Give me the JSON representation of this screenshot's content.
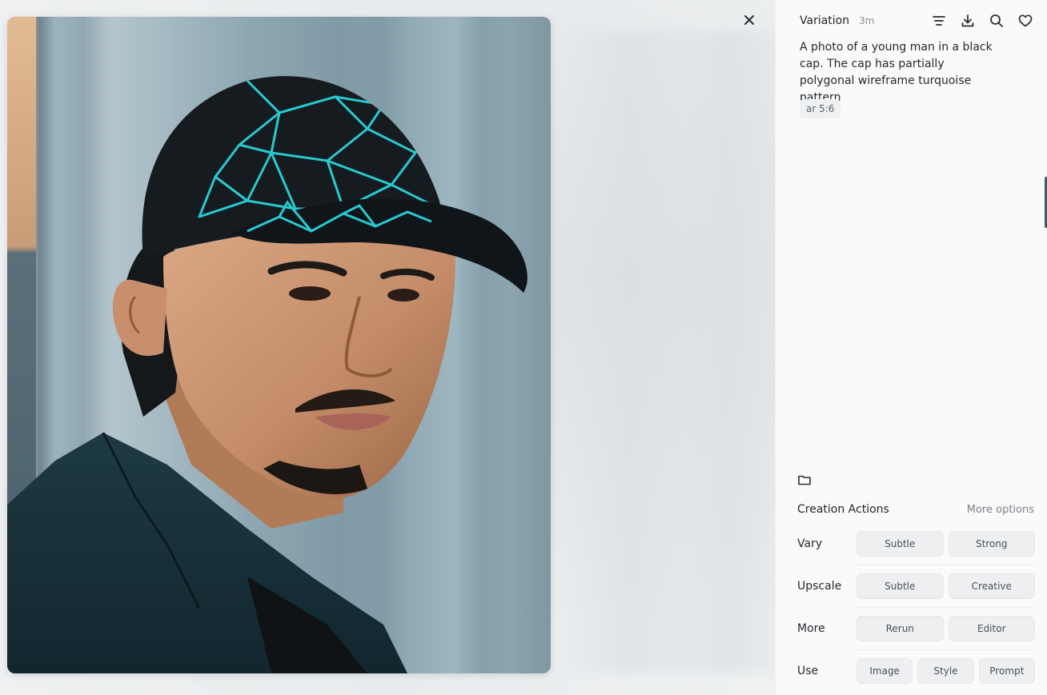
{
  "sidebar": {
    "title": "Variation",
    "age": "3m",
    "prompt": "A photo of a young man in a black cap. The cap has partially polygonal wireframe turquoise pattern",
    "tag": "ar 5:6",
    "icons": [
      "menu-icon",
      "download-icon",
      "search-icon",
      "heart-icon"
    ]
  },
  "actions": {
    "title": "Creation Actions",
    "more_options": "More options",
    "rows": [
      {
        "label": "Vary",
        "buttons": [
          "Subtle",
          "Strong"
        ]
      },
      {
        "label": "Upscale",
        "buttons": [
          "Subtle",
          "Creative"
        ]
      },
      {
        "label": "More",
        "buttons": [
          "Rerun",
          "Editor"
        ]
      },
      {
        "label": "Use",
        "buttons": [
          "Image",
          "Style",
          "Prompt"
        ]
      }
    ]
  },
  "colors": {
    "accent_turquoise": "#29c9cf",
    "cap_black": "#161b20",
    "sidebar_bg": "#fafafa",
    "button_bg": "#eeeff1"
  }
}
